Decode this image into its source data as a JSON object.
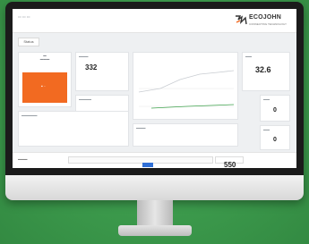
{
  "brand": {
    "name": "ECOJOHN",
    "tagline": "CONNECTING TECHNOLOGY",
    "accent": "#f26a21"
  },
  "tab": {
    "label": "Status"
  },
  "kpis": {
    "left_value": "332",
    "right_value": "32.6",
    "side_top_value": "0",
    "side_bottom_value": "0",
    "footer_value": "550"
  },
  "colors": {
    "background": "#3c9a4c",
    "tile": "#f26a21",
    "button": "#2f6fd6"
  }
}
